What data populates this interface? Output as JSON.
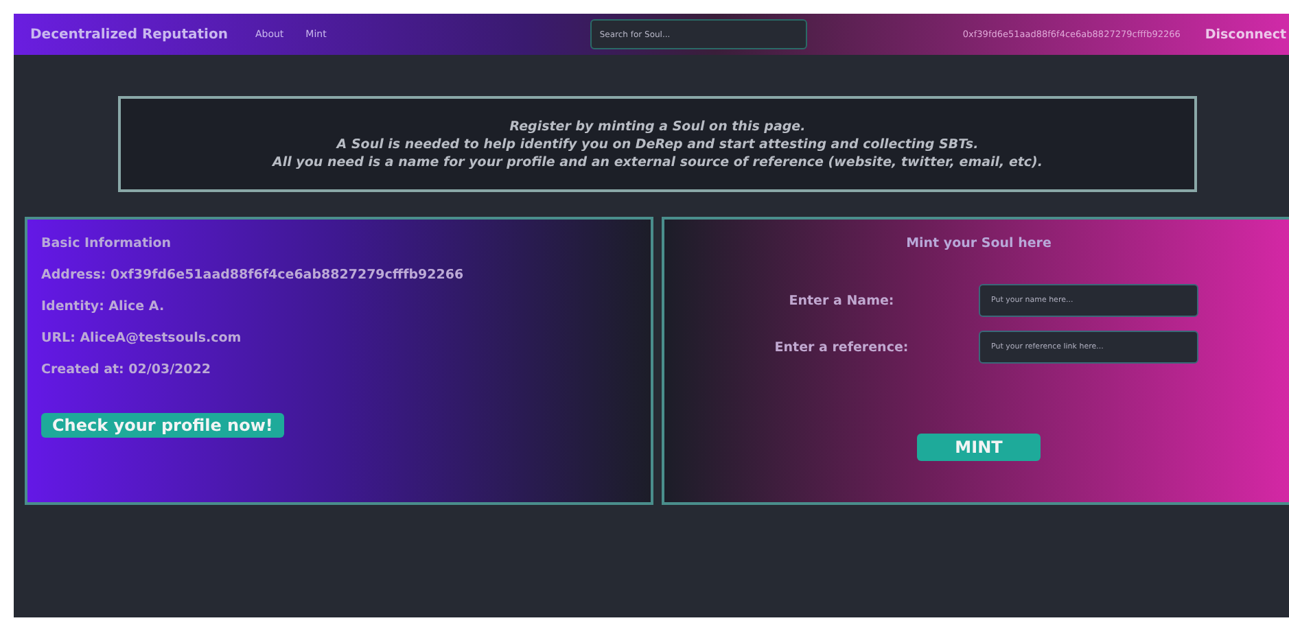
{
  "navbar": {
    "brand": "Decentralized Reputation",
    "links": [
      "About",
      "Mint"
    ],
    "search": {
      "placeholder": "Search for Soul..."
    },
    "wallet_address": "0xf39fd6e51aad88f6f4ce6ab8827279cfffb92266",
    "disconnect_button": "Disconnect"
  },
  "banner": {
    "lines": [
      "Register by minting a Soul on this page.",
      "A Soul is needed to help identify you on DeRep and start attesting and collecting SBTs.",
      "All you need is a name for your profile and an external source of reference (website, twitter, email, etc)."
    ]
  },
  "basic_info": {
    "title": "Basic Information",
    "fields": [
      "Address: 0xf39fd6e51aad88f6f4ce6ab8827279cfffb92266",
      "Identity: Alice A.",
      "URL: AliceA@testsouls.com",
      "Created at: 02/03/2022"
    ],
    "button": "Check your profile now!"
  },
  "mint": {
    "title": "Mint your Soul here",
    "fields": [
      {
        "label": "Enter a Name:",
        "placeholder": "Put your name here..."
      },
      {
        "label": "Enter a reference:",
        "placeholder": "Put your reference link here..."
      }
    ],
    "button": "MINT"
  }
}
